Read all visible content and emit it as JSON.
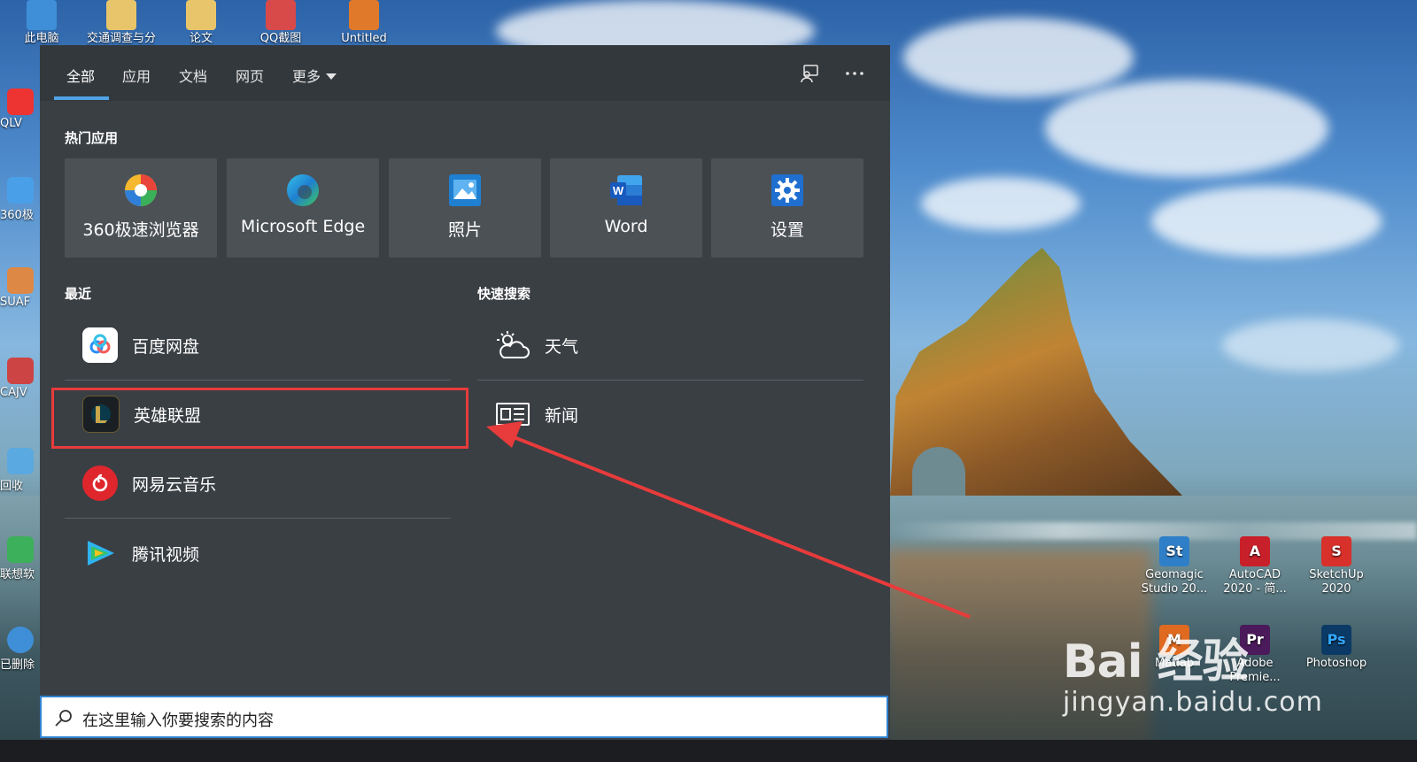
{
  "desktop": {
    "top_icons": [
      {
        "label": "此电脑",
        "color": "#3f8fd8"
      },
      {
        "label": "交通调查与分",
        "color": "#e8c56a"
      },
      {
        "label": "论文",
        "color": "#e8c56a"
      },
      {
        "label": "QQ截图",
        "color": "#d84a4a"
      },
      {
        "label": "Untitled",
        "color": "#e07a2a"
      }
    ],
    "left_icons": [
      {
        "label": "QLV",
        "color": "#e33"
      },
      {
        "label": "360极",
        "color": "#4aa0e8"
      },
      {
        "label": "SUAF",
        "color": "#d84"
      },
      {
        "label": "CAJV",
        "color": "#c44"
      },
      {
        "label": "回收",
        "color": "#5aa9e0"
      },
      {
        "label": "联想软",
        "color": "#3cb05a"
      },
      {
        "label": "已删除",
        "color": "#3f8fd8"
      }
    ],
    "right_icons": [
      {
        "line1": "Geomagic",
        "line2": "Studio 20...",
        "glyph": "St",
        "color": "#2f7fc8"
      },
      {
        "line1": "AutoCAD",
        "line2": "2020 - 简...",
        "glyph": "A",
        "color": "#c8202a"
      },
      {
        "line1": "SketchUp",
        "line2": "2020",
        "glyph": "S",
        "color": "#d8302a"
      },
      {
        "line1": "Matlab",
        "line2": "",
        "glyph": "M",
        "color": "#e06a20"
      },
      {
        "line1": "Adobe",
        "line2": "Premie...",
        "glyph": "Pr",
        "color": "#4a1a5a"
      },
      {
        "line1": "Photoshop",
        "line2": "",
        "glyph": "Ps",
        "color": "#0b3a66"
      }
    ]
  },
  "panel": {
    "tabs": [
      {
        "label": "全部",
        "active": true
      },
      {
        "label": "应用",
        "active": false
      },
      {
        "label": "文档",
        "active": false
      },
      {
        "label": "网页",
        "active": false
      },
      {
        "label": "更多",
        "active": false
      }
    ],
    "top_apps_title": "热门应用",
    "top_apps": [
      {
        "label": "360极速浏览器",
        "icon": "360-browser-icon"
      },
      {
        "label": "Microsoft Edge",
        "icon": "edge-icon"
      },
      {
        "label": "照片",
        "icon": "photos-icon"
      },
      {
        "label": "Word",
        "icon": "word-icon"
      },
      {
        "label": "设置",
        "icon": "settings-icon"
      }
    ],
    "recent_title": "最近",
    "recent": [
      {
        "label": "百度网盘",
        "icon": "baidu-netdisk-icon"
      },
      {
        "label": "英雄联盟",
        "icon": "league-of-legends-icon"
      },
      {
        "label": "网易云音乐",
        "icon": "netease-music-icon"
      },
      {
        "label": "腾讯视频",
        "icon": "tencent-video-icon"
      }
    ],
    "quick_title": "快速搜索",
    "quick": [
      {
        "label": "天气",
        "icon": "weather-icon"
      },
      {
        "label": "新闻",
        "icon": "news-icon"
      }
    ]
  },
  "search": {
    "placeholder": "在这里输入你要搜索的内容"
  },
  "watermark": {
    "main": "Bai 经验",
    "sub": "jingyan.baidu.com"
  },
  "colors": {
    "accent": "#4fa3e6",
    "highlight": "#e83b3b",
    "panel_bg": "#3a3f44"
  }
}
